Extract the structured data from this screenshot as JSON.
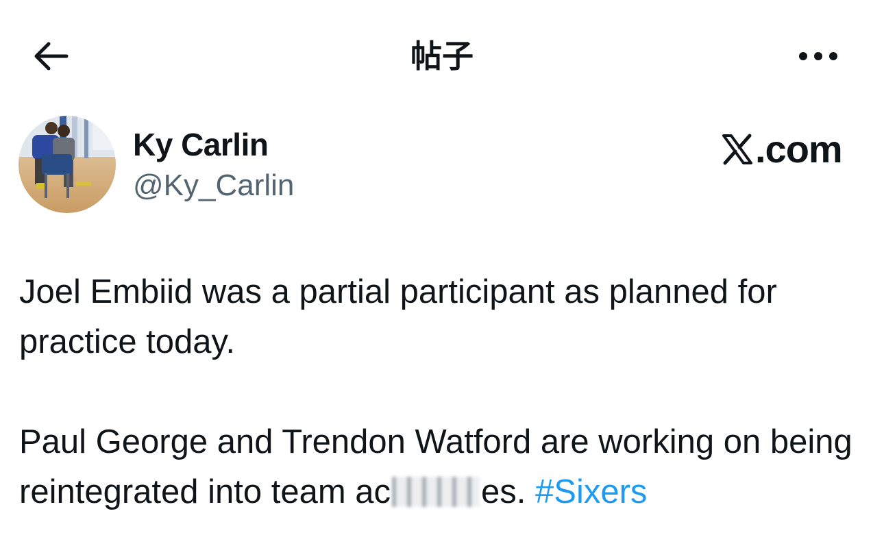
{
  "header": {
    "back_icon": "arrow-left-icon",
    "title": "帖子",
    "more_icon": "more-horizontal-icon"
  },
  "author": {
    "name": "Ky Carlin",
    "handle": "@Ky_Carlin"
  },
  "watermark": {
    "text": "X.com",
    "icon": "x-logo-icon"
  },
  "post": {
    "paragraph1": "Joel Embiid was a partial participant as planned for practice today.",
    "paragraph2_before": "Paul George and Trendon Watford are working on being reintegrated into team ac",
    "paragraph2_after": "es. ",
    "hashtag": "#Sixers"
  },
  "colors": {
    "text": "#0f1419",
    "secondary": "#536471",
    "link": "#1d9bf0",
    "background": "#ffffff"
  }
}
